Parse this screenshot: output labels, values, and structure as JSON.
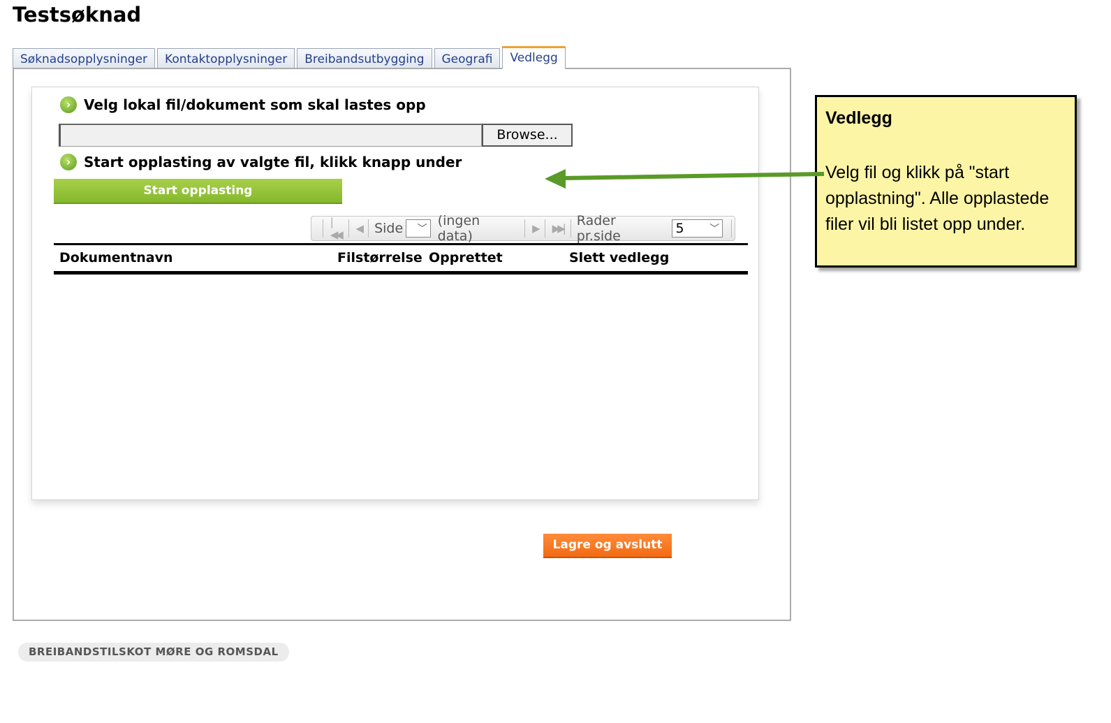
{
  "page": {
    "title": "Testsøknad"
  },
  "tabs": [
    {
      "label": "Søknadsopplysninger",
      "active": false
    },
    {
      "label": "Kontaktopplysninger",
      "active": false
    },
    {
      "label": "Breibandsutbygging",
      "active": false
    },
    {
      "label": "Geografi",
      "active": false
    },
    {
      "label": "Vedlegg",
      "active": true
    }
  ],
  "upload": {
    "step1_label": "Velg lokal fil/dokument som skal lastes opp",
    "file_value": "",
    "browse_label": "Browse...",
    "step2_label": "Start opplasting av valgte fil, klikk knapp under",
    "start_button": "Start opplasting"
  },
  "pager": {
    "side_label": "Side",
    "page_value": "",
    "no_data": "(ingen data)",
    "rows_label": "Rader pr.side",
    "rows_value": "5"
  },
  "grid": {
    "columns": [
      "Dokumentnavn",
      "Filstørrelse",
      "Opprettet",
      "Slett vedlegg"
    ],
    "rows": []
  },
  "actions": {
    "save_button": "Lagre og avslutt"
  },
  "footer": {
    "text": "BREIBANDSTILSKOT MØRE OG ROMSDAL"
  },
  "callout": {
    "title": "Vedlegg",
    "body": "Velg fil og klikk på \"start opplastning\". Alle opplastede filer vil bli listet opp under."
  },
  "colors": {
    "accent_green": "#84b82c",
    "accent_orange": "#f26a12",
    "tab_text": "#27408b",
    "callout_bg": "#fdf5a6",
    "arrow": "#5a9a28"
  },
  "icons": {
    "step_bullet": "chevron-right-circle-icon",
    "pager_first": "first-page-icon",
    "pager_prev": "prev-page-icon",
    "pager_next": "next-page-icon",
    "pager_last": "last-page-icon",
    "dropdown": "chevron-down-icon"
  }
}
